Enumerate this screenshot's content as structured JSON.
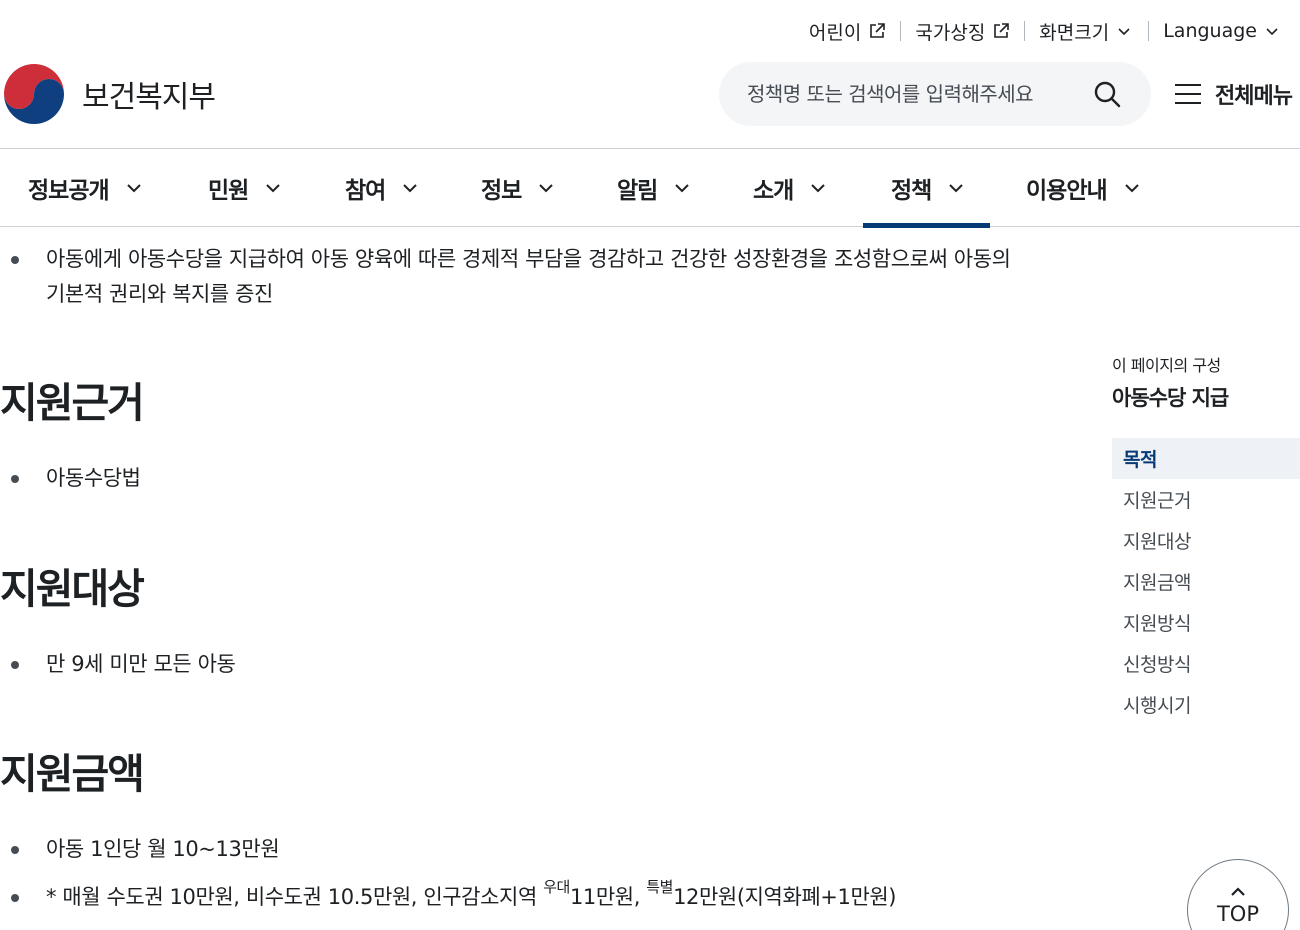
{
  "utility": {
    "kids": "어린이",
    "symbols": "국가상징",
    "font_size": "화면크기",
    "language": "Language"
  },
  "header": {
    "logo_text": "보건복지부",
    "search_placeholder": "정책명 또는 검색어를 입력해주세요",
    "all_menu": "전체메뉴"
  },
  "nav": {
    "items": [
      "정보공개",
      "민원",
      "참여",
      "정보",
      "알림",
      "소개",
      "정책",
      "이용안내"
    ],
    "active": "정책"
  },
  "content": {
    "purpose_text_line1": "아동에게 아동수당을 지급하여 아동 양육에 따른 경제적 부담을 경감하고 건강한 성장환경을 조성함으로써 아동의",
    "purpose_text_line2": "기본적 권리와 복지를 증진",
    "basis_title": "지원근거",
    "basis_text": "아동수당법",
    "target_title": "지원대상",
    "target_text": "만 9세 미만 모든 아동",
    "amount_title": "지원금액",
    "amount_text": "아동 1인당 월 10~13만원",
    "amount_note": {
      "part1": "* 매월 수도권 10만원, 비수도권 10.5만원, 인구감소지역 ",
      "sup1": "우대",
      "part2": "11만원, ",
      "sup2": "특별",
      "part3": "12만원(지역화폐+1만원)"
    }
  },
  "toc": {
    "caption": "이 페이지의 구성",
    "title": "아동수당 지급",
    "items": [
      "목적",
      "지원근거",
      "지원대상",
      "지원금액",
      "지원방식",
      "신청방식",
      "시행시기"
    ],
    "active": "목적"
  },
  "top_button": {
    "label": "TOP"
  },
  "colors": {
    "primary": "#063a74",
    "text": "#1e2124",
    "muted": "#464c53",
    "search_bg": "#f4f5f6",
    "toc_active_bg": "#eef2f7",
    "logo_red": "#cd2e3a",
    "logo_blue": "#0f3f7f"
  },
  "icons": {
    "external_link": "external-link-icon",
    "chevron": "chevron-down-icon",
    "search": "search-icon",
    "menu": "hamburger-icon",
    "top": "chevron-up-icon"
  }
}
